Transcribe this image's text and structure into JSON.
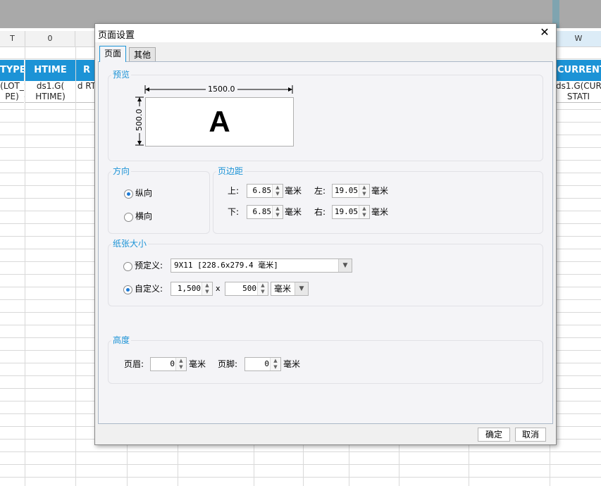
{
  "spreadsheet": {
    "columns": [
      "T",
      "0",
      "W"
    ],
    "headers": [
      "TYPE",
      "HTIME",
      "R",
      "CURRENT_"
    ],
    "cells": [
      "(LOT_ PE)",
      "ds1.G( HTIME)",
      "d RT",
      "ds1.G(CUR STATI"
    ]
  },
  "dialog": {
    "title": "页面设置",
    "close_glyph": "✕",
    "tabs": [
      {
        "label": "页面",
        "active": true
      },
      {
        "label": "其他",
        "active": false
      }
    ],
    "preview": {
      "title": "预览",
      "width_label": "1500.0",
      "height_label": "500.0",
      "letter": "A"
    },
    "orientation": {
      "title": "方向",
      "options": [
        {
          "label": "纵向",
          "selected": true
        },
        {
          "label": "横向",
          "selected": false
        }
      ]
    },
    "margins": {
      "title": "页边距",
      "top_label": "上:",
      "top_value": "6.85",
      "left_label": "左:",
      "left_value": "19.05",
      "bottom_label": "下:",
      "bottom_value": "6.85",
      "right_label": "右:",
      "right_value": "19.05",
      "unit": "毫米"
    },
    "paper": {
      "title": "纸张大小",
      "predefined_label": "预定义:",
      "predefined_value": "9X11 [228.6x279.4 毫米]",
      "predefined_selected": false,
      "custom_label": "自定义:",
      "custom_selected": true,
      "custom_width": "1,500",
      "times": "x",
      "custom_height": "500",
      "unit_value": "毫米"
    },
    "height": {
      "title": "高度",
      "header_label": "页眉:",
      "header_value": "0",
      "footer_label": "页脚:",
      "footer_value": "0",
      "unit": "毫米"
    },
    "ok_label": "确定",
    "cancel_label": "取消"
  },
  "colors": {
    "accent": "#1c93d6",
    "header_bg": "#1c93d6"
  }
}
